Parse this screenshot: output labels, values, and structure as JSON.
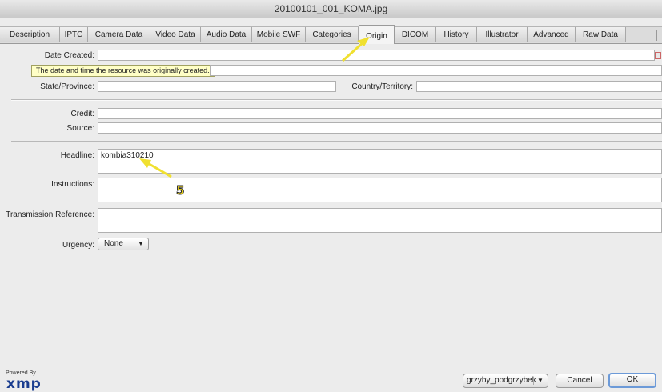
{
  "window": {
    "title": "20100101_001_KOMA.jpg"
  },
  "tabs": [
    {
      "label": "Description"
    },
    {
      "label": "IPTC"
    },
    {
      "label": "Camera Data"
    },
    {
      "label": "Video Data"
    },
    {
      "label": "Audio Data"
    },
    {
      "label": "Mobile SWF"
    },
    {
      "label": "Categories"
    },
    {
      "label": "Origin",
      "active": true
    },
    {
      "label": "DICOM"
    },
    {
      "label": "History"
    },
    {
      "label": "Illustrator"
    },
    {
      "label": "Advanced"
    },
    {
      "label": "Raw Data"
    }
  ],
  "form": {
    "date_created_label": "Date Created:",
    "date_created_value": "",
    "tooltip": "The date and time the resource was originally created.",
    "state_label": "State/Province:",
    "state_value": "",
    "country_label": "Country/Territory:",
    "country_value": "",
    "credit_label": "Credit:",
    "credit_value": "",
    "source_label": "Source:",
    "source_value": "",
    "headline_label": "Headline:",
    "headline_value": "kombia310210",
    "instructions_label": "Instructions:",
    "instructions_value": "",
    "transmission_label": "Transmission Reference:",
    "transmission_value": "",
    "urgency_label": "Urgency:",
    "urgency_value": "None"
  },
  "footer": {
    "powered_by": "Powered By",
    "logo_text": "xmp",
    "template_value": "grzyby_podgrzybek",
    "cancel_label": "Cancel",
    "ok_label": "OK"
  },
  "annotation": {
    "marker": "5",
    "arrow_color": "#f0e030"
  },
  "icons": {
    "calendar": "calendar-icon",
    "dropdown": "chevron-down-icon"
  }
}
